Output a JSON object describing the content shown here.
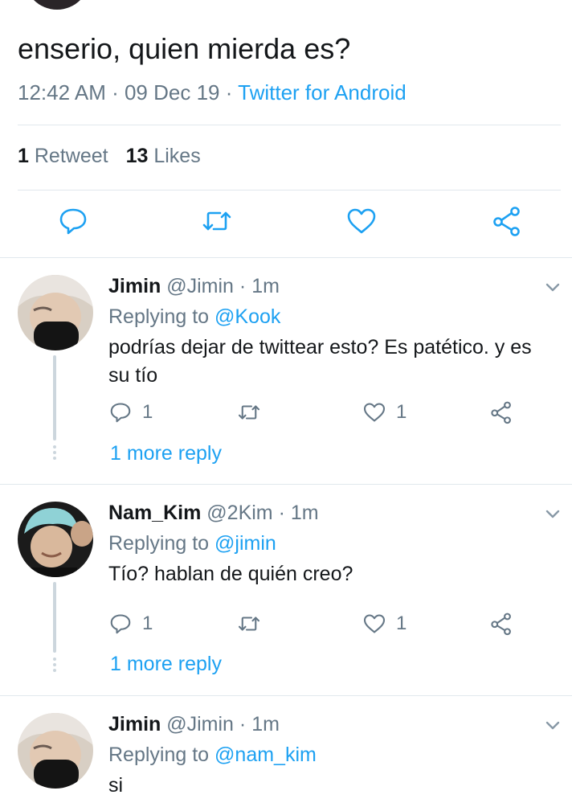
{
  "tweet": {
    "text": "enserio, quien mierda es?",
    "time": "12:42 AM",
    "sep1": " · ",
    "date": "09 Dec 19",
    "sep2": " · ",
    "client": "Twitter for Android",
    "retweet_count": "1",
    "retweet_label": "Retweet",
    "like_count": "13",
    "like_label": "Likes"
  },
  "replies": [
    {
      "name": "Jimin",
      "handle": "@Jimin",
      "sep": " · ",
      "time": "1m",
      "replying_prefix": "Replying to ",
      "replying_to": "@Kook",
      "text": "podrías dejar de twittear esto? Es patético. y es su tío",
      "reply_count": "1",
      "like_count": "1",
      "more_replies": "1 more reply"
    },
    {
      "name": "Nam_Kim",
      "handle": "@2Kim",
      "sep": " · ",
      "time": "1m",
      "replying_prefix": "Replying to ",
      "replying_to": "@jimin",
      "text": "Tío? hablan de quién creo?",
      "reply_count": "1",
      "like_count": "1",
      "more_replies": "1 more reply"
    },
    {
      "name": "Jimin",
      "handle": "@Jimin",
      "sep": " · ",
      "time": "1m",
      "replying_prefix": "Replying to ",
      "replying_to": "@nam_kim",
      "text": "si"
    }
  ],
  "icons": {
    "reply": "reply-icon",
    "retweet": "retweet-icon",
    "like": "heart-icon",
    "share": "share-icon",
    "menu": "chevron-down-icon"
  },
  "colors": {
    "accent": "#1da1f2",
    "muted": "#657786",
    "text": "#14171a",
    "divider": "#e1e8ed"
  }
}
